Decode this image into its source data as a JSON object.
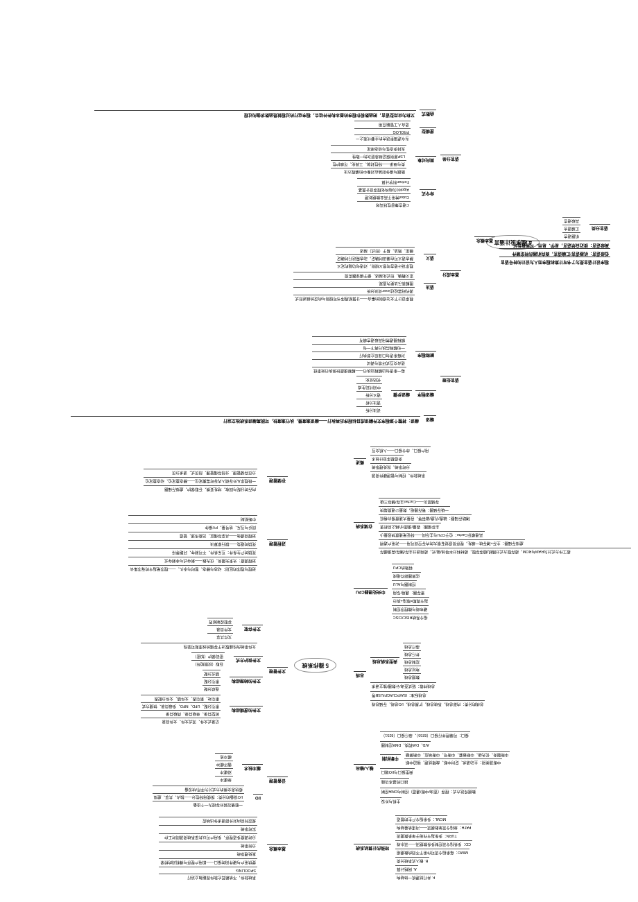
{
  "map1": {
    "center": "4 程序设计语言",
    "left": {
      "label": "基本概念",
      "items": [
        "程序设计语言是为了书写计算机程序而人为设计的符号语言",
        "低级语言：机器语言/汇编语言，面向机器的特定硬件",
        "高级语言：接近自然语言，易学、易用、可移植性好"
      ],
      "sub": {
        "label": "语言分类",
        "items": [
          "机器语言",
          "汇编语言",
          "高级语言"
        ]
      }
    },
    "right_language": {
      "label": "语言处理",
      "items": [
        "编译：将整个源程序文件翻译成目标程序后再执行——编译速度慢，执行速度快，可脱离编译系统独立运行"
      ],
      "compile_steps": {
        "label": "编译步骤",
        "outer": "编译程序",
        "items": [
          "词法分析",
          "语法分析",
          "语义分析",
          "中间代码生成",
          "代码优化"
        ]
      },
      "interpret": {
        "label": "解释程序",
        "items": [
          "每一条语句边解释边执行——解释速度快但执行效率低",
          "适合交互式环境与调试",
          "对每条语句口译后立即执行",
          "一句解释后执行再下一句",
          "解释器通常用高级语言编写"
        ]
      }
    },
    "right_basic": {
      "label": "基本成分",
      "syntax_items": [
        "程序设计下文法规则的集合——计算机程序书写规则与约定的描述形式",
        "源代码需经过lexer词法分析",
        "图解表示法更为直观",
        "定义精确、形式化描述、便于编译器实现"
      ],
      "syntax_label": "语法",
      "semantic_items": [
        "程序设计语言的意义规则，对语句功能的定义",
        "静态语义可在编译时确定，动态需运行时确定",
        "确定、简洁、易于（形式）描述"
      ],
      "semantic_label": "语义"
    },
    "right_category": {
      "label": "语言分类",
      "imperative": {
        "label": "命令式",
        "items": [
          "C语言兼容性好高效",
          "Cobol常用于商业数据处理",
          "Algol60为结构化程序设计奠基",
          "Fortran科学计算"
        ]
      },
      "oop": {
        "label": "面向对象",
        "items": [
          "数据与操作封装在对象中的编程方法",
          "类与继承——特性封装、工具化、可维护性",
          "LSP原则保证继承层次的一致性",
          "支持多态性与动态绑定"
        ]
      },
      "logic": {
        "label": "逻辑型",
        "items": [
          "当今逻辑型语言的主要代表之一",
          "PROLOG",
          "适合人工智能应用"
        ]
      },
      "functional": {
        "label": "函数式",
        "items": [
          "又称为应用型语言，把函数视作程序的基本构件并组合，程序运行的过程就是函数求值的过程"
        ]
      }
    }
  },
  "map2": {
    "center": "5 操作系统",
    "tr": {
      "label": "基本概念",
      "items": [
        "系统软件，不依赖其它软件而能独立运行",
        "SPOOLING",
        "提供用户与硬件间的接口——即用户程序与裸机间的桥梁",
        "批处理系统",
        "分时系统",
        "分时调度多道程序，多用户可以共享系统资源同时工作",
        "实时系统",
        "规定时间内对外部请求作出响应"
      ]
    },
    "r_memory": {
      "label": "设备管理",
      "io": {
        "label": "I/O",
        "items": [
          "一般情况将外存视为一个设备",
          "I/O设备的分类：按使用特性分——独占、共享、虚拟",
          "按信息交换的方式分为字符/块设备"
        ]
      },
      "buffer": {
        "label": "缓冲技术",
        "items": [
          "单缓冲",
          "双缓冲",
          "循环缓冲",
          "缓冲池"
        ]
      }
    },
    "r_file": {
      "label": "文件管理",
      "logic": {
        "label": "文件的逻辑结构",
        "items": [
          "记录式文件、流式文件、文件目录",
          "树型目录、单级目录、两级目录"
        ],
        "sub_items": [
          "索引分配、UFD、MFD、多级目录、快捷方式",
          "索引块、索引表、文件链、文件分配表"
        ]
      },
      "phys": {
        "label": "文件的物理结构",
        "items": [
          "连续分配",
          "索引分配",
          "链式分配"
        ]
      },
      "protect": {
        "label": "文件保护方式",
        "items": [
          "存取（权限矩阵）",
          "密码保护（加密）"
        ]
      },
      "more": [
        "文件系统的性能取决于存储的效率和可靠性",
        "文件存取",
        "文件共享",
        "文件目录",
        "存取控制矩阵"
      ]
    },
    "r_process": {
      "label": "进程管理",
      "items": [
        "进程与程序的区别：动态与静态、暂时与永久、——程序是指令的有序集合",
        "进程调度：先来先服务、优先数——剥夺式与非剥夺式",
        "死锁的产生条件：互斥条件、不可剥夺、环路等待",
        "死锁的避免——银行家算法",
        "进程间通信——共享存储区、消息传递、管道",
        "同步与互斥、信号量、PV操作",
        "中断机制"
      ]
    },
    "b": {
      "label": "存储管理",
      "items": [
        "内存的分配与回收、地址变换、存取保护、虚拟存储器",
        "一段程序从外存调入内存时需要定位——静态重定位、动态重定位",
        "分页存储管理、分段存储管理、段页式、请求分页"
      ]
    },
    "tl": {
      "label": "特殊的计算机系统",
      "items": [
        "F. 并行处理机一体结构",
        "A. 网格计算",
        "B. 嵌入式系统分类",
        "MIMO：每条指令流可作用于不同的数据组",
        "CD：多条指令流控制多条数据流——流水线",
        "TURN：多条指令作用于单条数据流",
        "PATH：单指令流单数据流——冯诺依曼结构",
        "MCML：多条指令产生的管道"
      ]
    },
    "l_io": {
      "label": "输入/输出",
      "items": [
        "主机与外设",
        "数据传送方式：程序（查询/中断/通道）控制与DMA控制",
        "接口的基本功能",
        "典型接口与I/O端口"
      ],
      "channel": {
        "label": "中断机制",
        "items": [
          "中断源类别：主动请求、定时中断、故障处理、强迫中断",
          "中断服务、优先级、中断嵌套、中断号、中断响应、中断屏蔽"
        ]
      },
      "special": [
        "A/D、D/A转换、DMA控制器",
        "接口：可编程并行接口（8255）、串行接口（8251）"
      ]
    },
    "l_bus": {
      "label": "总线",
      "items": [
        "总线的分类：内部总线、系统总线、扩展总线、I/O总线、存储总线",
        "总线标准：ISA/PCI/AGP/USB等",
        "总线仲裁：链式查询/计数器/独立请求"
      ],
      "sub": {
        "label": "典型系统总线",
        "items": [
          "数据总线",
          "地址总线",
          "控制总线",
          "并行总线",
          "串行总线"
        ]
      }
    },
    "l_cpu": {
      "label": "中央处理器CPU",
      "items": [
        "指令系统RISC/CISC",
        "硬布线与微程序控制",
        "指令周期=取指+执行",
        "寄存器：通用/专用",
        "控制器与ALU",
        "运算器部件组成"
      ],
      "special_label": "特殊的CPU"
    },
    "l_mem": {
      "label": "存储系统",
      "items": [
        "按工作方式分为RAM与ROM，按存取方式分随机/顺序存取，按材料分半导体/磁/光，按用途分主存/辅存/高速缓存",
        "虚拟存储器：主存+辅存统一编址，程序员感觉有很大的内存空间可用——对用户透明",
        "高速缓存Cache：位于CPU与主存间——特征是速度快容量小",
        "主存储器：容量/速度/价格之间折衷",
        "辅助存储器：磁盘/光盘/磁带等，容量大速度慢价格低",
        "一级存储器：寄存器组，数量少速度最快",
        "存储层次——Cache/主存/辅存三级"
      ]
    },
    "bl": {
      "label": "概述",
      "items": [
        "系统软件、控制与管理硬件资源",
        "分时系统、批处理系统",
        "多道程序设计技术",
        "用户接口、命令接口——人机交互"
      ]
    }
  }
}
